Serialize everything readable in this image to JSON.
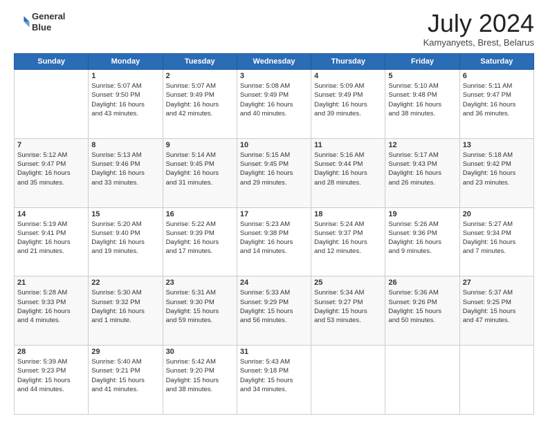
{
  "header": {
    "logo_line1": "General",
    "logo_line2": "Blue",
    "month": "July 2024",
    "location": "Kamyanyets, Brest, Belarus"
  },
  "calendar": {
    "days_of_week": [
      "Sunday",
      "Monday",
      "Tuesday",
      "Wednesday",
      "Thursday",
      "Friday",
      "Saturday"
    ],
    "weeks": [
      [
        {
          "day": "",
          "content": ""
        },
        {
          "day": "1",
          "content": "Sunrise: 5:07 AM\nSunset: 9:50 PM\nDaylight: 16 hours\nand 43 minutes."
        },
        {
          "day": "2",
          "content": "Sunrise: 5:07 AM\nSunset: 9:49 PM\nDaylight: 16 hours\nand 42 minutes."
        },
        {
          "day": "3",
          "content": "Sunrise: 5:08 AM\nSunset: 9:49 PM\nDaylight: 16 hours\nand 40 minutes."
        },
        {
          "day": "4",
          "content": "Sunrise: 5:09 AM\nSunset: 9:49 PM\nDaylight: 16 hours\nand 39 minutes."
        },
        {
          "day": "5",
          "content": "Sunrise: 5:10 AM\nSunset: 9:48 PM\nDaylight: 16 hours\nand 38 minutes."
        },
        {
          "day": "6",
          "content": "Sunrise: 5:11 AM\nSunset: 9:47 PM\nDaylight: 16 hours\nand 36 minutes."
        }
      ],
      [
        {
          "day": "7",
          "content": "Sunrise: 5:12 AM\nSunset: 9:47 PM\nDaylight: 16 hours\nand 35 minutes."
        },
        {
          "day": "8",
          "content": "Sunrise: 5:13 AM\nSunset: 9:46 PM\nDaylight: 16 hours\nand 33 minutes."
        },
        {
          "day": "9",
          "content": "Sunrise: 5:14 AM\nSunset: 9:45 PM\nDaylight: 16 hours\nand 31 minutes."
        },
        {
          "day": "10",
          "content": "Sunrise: 5:15 AM\nSunset: 9:45 PM\nDaylight: 16 hours\nand 29 minutes."
        },
        {
          "day": "11",
          "content": "Sunrise: 5:16 AM\nSunset: 9:44 PM\nDaylight: 16 hours\nand 28 minutes."
        },
        {
          "day": "12",
          "content": "Sunrise: 5:17 AM\nSunset: 9:43 PM\nDaylight: 16 hours\nand 26 minutes."
        },
        {
          "day": "13",
          "content": "Sunrise: 5:18 AM\nSunset: 9:42 PM\nDaylight: 16 hours\nand 23 minutes."
        }
      ],
      [
        {
          "day": "14",
          "content": "Sunrise: 5:19 AM\nSunset: 9:41 PM\nDaylight: 16 hours\nand 21 minutes."
        },
        {
          "day": "15",
          "content": "Sunrise: 5:20 AM\nSunset: 9:40 PM\nDaylight: 16 hours\nand 19 minutes."
        },
        {
          "day": "16",
          "content": "Sunrise: 5:22 AM\nSunset: 9:39 PM\nDaylight: 16 hours\nand 17 minutes."
        },
        {
          "day": "17",
          "content": "Sunrise: 5:23 AM\nSunset: 9:38 PM\nDaylight: 16 hours\nand 14 minutes."
        },
        {
          "day": "18",
          "content": "Sunrise: 5:24 AM\nSunset: 9:37 PM\nDaylight: 16 hours\nand 12 minutes."
        },
        {
          "day": "19",
          "content": "Sunrise: 5:26 AM\nSunset: 9:36 PM\nDaylight: 16 hours\nand 9 minutes."
        },
        {
          "day": "20",
          "content": "Sunrise: 5:27 AM\nSunset: 9:34 PM\nDaylight: 16 hours\nand 7 minutes."
        }
      ],
      [
        {
          "day": "21",
          "content": "Sunrise: 5:28 AM\nSunset: 9:33 PM\nDaylight: 16 hours\nand 4 minutes."
        },
        {
          "day": "22",
          "content": "Sunrise: 5:30 AM\nSunset: 9:32 PM\nDaylight: 16 hours\nand 1 minute."
        },
        {
          "day": "23",
          "content": "Sunrise: 5:31 AM\nSunset: 9:30 PM\nDaylight: 15 hours\nand 59 minutes."
        },
        {
          "day": "24",
          "content": "Sunrise: 5:33 AM\nSunset: 9:29 PM\nDaylight: 15 hours\nand 56 minutes."
        },
        {
          "day": "25",
          "content": "Sunrise: 5:34 AM\nSunset: 9:27 PM\nDaylight: 15 hours\nand 53 minutes."
        },
        {
          "day": "26",
          "content": "Sunrise: 5:36 AM\nSunset: 9:26 PM\nDaylight: 15 hours\nand 50 minutes."
        },
        {
          "day": "27",
          "content": "Sunrise: 5:37 AM\nSunset: 9:25 PM\nDaylight: 15 hours\nand 47 minutes."
        }
      ],
      [
        {
          "day": "28",
          "content": "Sunrise: 5:39 AM\nSunset: 9:23 PM\nDaylight: 15 hours\nand 44 minutes."
        },
        {
          "day": "29",
          "content": "Sunrise: 5:40 AM\nSunset: 9:21 PM\nDaylight: 15 hours\nand 41 minutes."
        },
        {
          "day": "30",
          "content": "Sunrise: 5:42 AM\nSunset: 9:20 PM\nDaylight: 15 hours\nand 38 minutes."
        },
        {
          "day": "31",
          "content": "Sunrise: 5:43 AM\nSunset: 9:18 PM\nDaylight: 15 hours\nand 34 minutes."
        },
        {
          "day": "",
          "content": ""
        },
        {
          "day": "",
          "content": ""
        },
        {
          "day": "",
          "content": ""
        }
      ]
    ]
  }
}
